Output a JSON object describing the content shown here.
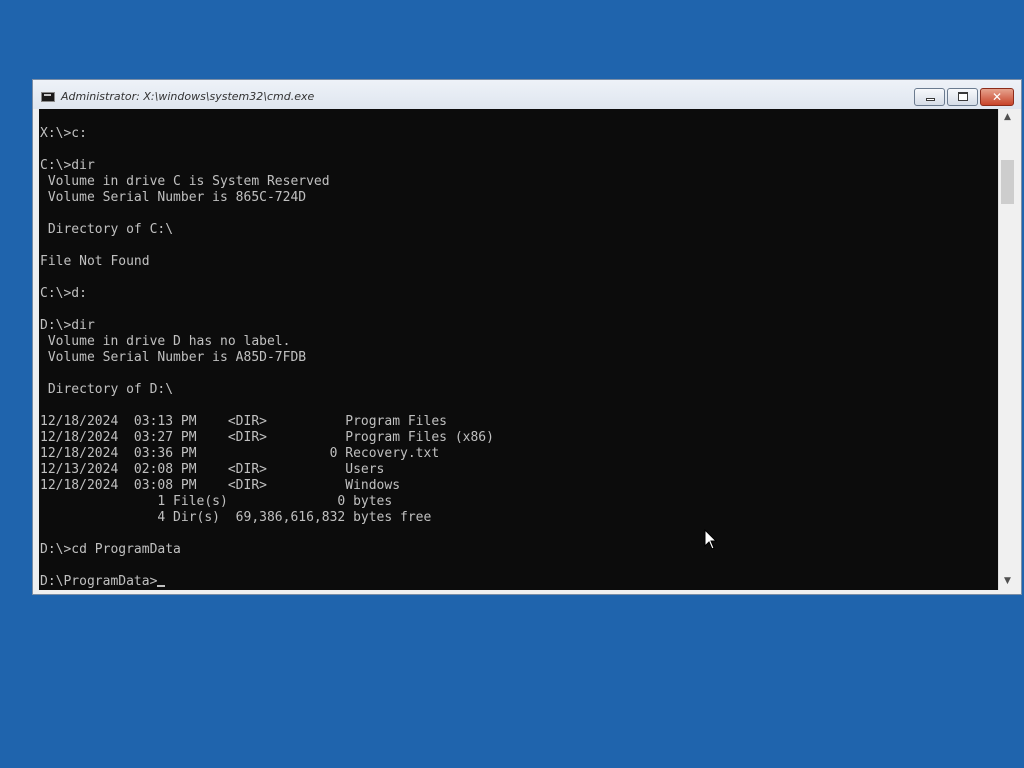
{
  "window": {
    "title": "Administrator: X:\\windows\\system32\\cmd.exe",
    "icon": "cmd-icon",
    "controls": {
      "minimize_icon": "minimize-icon",
      "maximize_icon": "maximize-icon",
      "close_icon": "close-icon",
      "close_glyph": "✕"
    }
  },
  "colors": {
    "desktop_background": "#1f64ad",
    "console_background": "#0c0c0c",
    "console_text": "#c0c0c0",
    "close_button": "#c8442a"
  },
  "console": {
    "lines": [
      "X:\\>c:",
      "",
      "C:\\>dir",
      " Volume in drive C is System Reserved",
      " Volume Serial Number is 865C-724D",
      "",
      " Directory of C:\\",
      "",
      "File Not Found",
      "",
      "C:\\>d:",
      "",
      "D:\\>dir",
      " Volume in drive D has no label.",
      " Volume Serial Number is A85D-7FDB",
      "",
      " Directory of D:\\",
      "",
      "12/18/2024  03:13 PM    <DIR>          Program Files",
      "12/18/2024  03:27 PM    <DIR>          Program Files (x86)",
      "12/18/2024  03:36 PM                 0 Recovery.txt",
      "12/13/2024  02:08 PM    <DIR>          Users",
      "12/18/2024  03:08 PM    <DIR>          Windows",
      "               1 File(s)              0 bytes",
      "               4 Dir(s)  69,386,616,832 bytes free",
      "",
      "D:\\>cd ProgramData",
      ""
    ],
    "prompt": "D:\\ProgramData>"
  },
  "scrollbar": {
    "up_arrow": "▲",
    "down_arrow": "▼",
    "up_icon": "scroll-up-arrow-icon",
    "down_icon": "scroll-down-arrow-icon"
  },
  "pointer": {
    "icon": "mouse-pointer-icon"
  }
}
